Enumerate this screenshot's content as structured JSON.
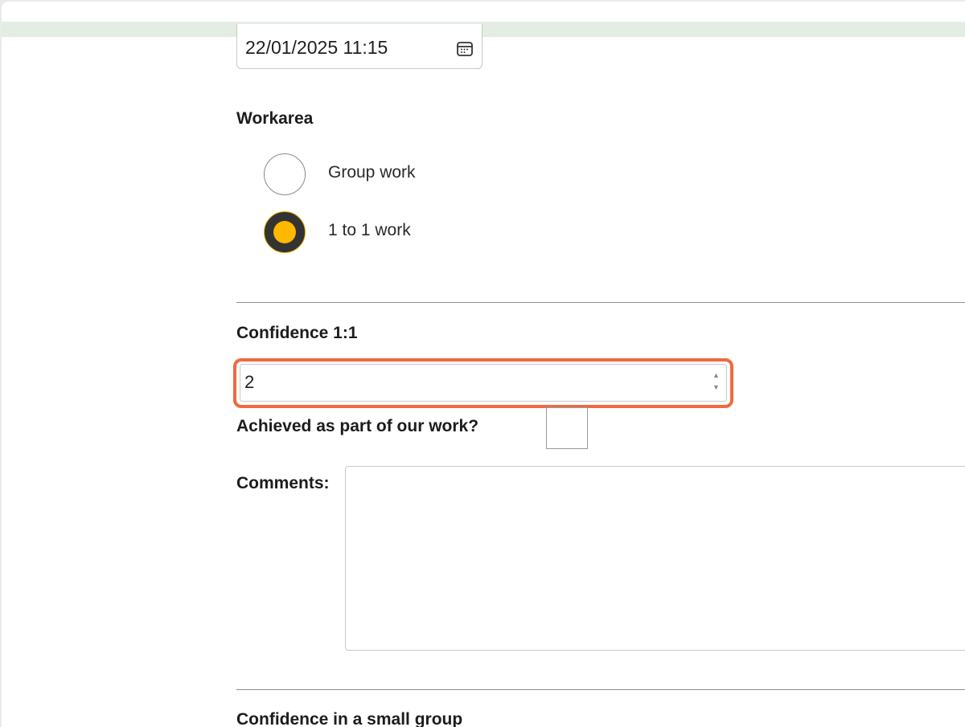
{
  "datetime_field": {
    "value": "22/01/2025 11:15",
    "icon": "calendar-icon"
  },
  "workarea": {
    "label": "Workarea",
    "options": [
      {
        "label": "Group work",
        "selected": false
      },
      {
        "label": "1 to 1 work",
        "selected": true
      }
    ],
    "selected_color": "#ffb800"
  },
  "confidence_1to1": {
    "label": "Confidence 1:1",
    "value": "2",
    "highlight_color": "#ef6a3f"
  },
  "achieved": {
    "label": "Achieved as part of our work?",
    "checked": false
  },
  "comments": {
    "label": "Comments:",
    "value": ""
  },
  "confidence_small_group": {
    "label": "Confidence in a small group"
  }
}
